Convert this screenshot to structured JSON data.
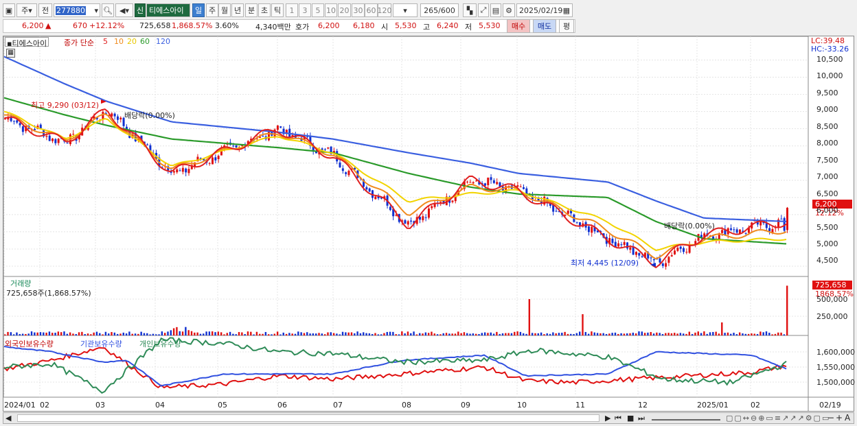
{
  "toolbar": {
    "code_prefix": "주",
    "all_label": "전",
    "stock_code": "277880",
    "credit_badge": "신",
    "stock_name": "티에스아이",
    "periods": [
      "일",
      "주",
      "월",
      "년",
      "분",
      "초",
      "틱"
    ],
    "minute_options": [
      "1",
      "3",
      "5",
      "10",
      "20",
      "30",
      "60",
      "120"
    ],
    "count_display": "265",
    "count_total": "/600",
    "date_value": "2025/02/19"
  },
  "quote": {
    "price": "6,200",
    "change": "670",
    "change_pct": "+12.12%",
    "volume": "725,658",
    "volume_ratio": "1,868.57%",
    "turnover": "3.60%",
    "amount": "4,340백만",
    "bid_label": "호가",
    "bid1": "6,200",
    "bid2": "6,180",
    "open_label": "시",
    "open": "5,530",
    "high_label": "고",
    "high": "6,240",
    "low_label": "저",
    "low": "5,530",
    "buy_label": "매수",
    "sell_label": "매도",
    "flat_label": "평"
  },
  "legend": {
    "name": "티에스아이",
    "ma_title": "종가 단순",
    "ma_periods": [
      "5",
      "10",
      "20",
      "60",
      "120"
    ],
    "lc": "LC:39.48",
    "hc": "HC:-33.26",
    "volume_title": "거래량",
    "volume_info": "725,658주(1,868.57%)",
    "holdings": [
      "외국인보유수량",
      "기관보유수량",
      "개인보유수량"
    ]
  },
  "annotations": {
    "high": "최고 9,290 (03/12)",
    "low": "최저 4,445 (12/09)",
    "dividend": "배당락(0.00%)",
    "last_price": "6,200",
    "last_pct": "12.12%",
    "last_volume": "725,658",
    "last_volume_pct": "1868.57%"
  },
  "axes": {
    "price_ticks": [
      "10,500",
      "10,000",
      "9,500",
      "9,000",
      "8,500",
      "8,000",
      "7,500",
      "7,000",
      "6,500",
      "6,000",
      "5,500",
      "5,000",
      "4,500"
    ],
    "volume_ticks": [
      "500,000",
      "250,000"
    ],
    "holding_ticks": [
      "1,600,000",
      "1,550,000",
      "1,500,000"
    ],
    "date_labels": [
      "2024/01",
      "02",
      "03",
      "04",
      "05",
      "06",
      "07",
      "08",
      "09",
      "10",
      "11",
      "12",
      "2025/01",
      "02"
    ],
    "end_date": "02/19"
  },
  "colors": {
    "ma5": "#e02020",
    "ma10": "#f08a1c",
    "ma20": "#f2d400",
    "ma60": "#2a9a2a",
    "ma120": "#3a5fe0",
    "up": "#e01010",
    "down": "#1030d0",
    "foreign": "#e01010",
    "institution": "#3050e0",
    "individual": "#2e8b57"
  },
  "chart_data": {
    "type": "line",
    "ma_keyframes": {
      "dates": [
        "2024/01/02",
        "2024/02/15",
        "2024/03/12",
        "2024/04/20",
        "2024/06/05",
        "2024/07/10",
        "2024/08/12",
        "2024/09/10",
        "2024/10/10",
        "2024/11/20",
        "2024/12/09",
        "2025/01/05",
        "2025/02/19"
      ],
      "ma5": [
        8800,
        8100,
        9050,
        7200,
        8500,
        7700,
        5700,
        7000,
        6700,
        5300,
        4600,
        5400,
        5800
      ],
      "ma20": [
        9000,
        8200,
        8800,
        7400,
        8300,
        7800,
        6400,
        6600,
        6700,
        5800,
        5000,
        5200,
        5300
      ],
      "ma60": [
        9400,
        8900,
        8600,
        8200,
        7950,
        7800,
        7200,
        6800,
        6600,
        6500,
        5800,
        5300,
        5150
      ],
      "ma120": [
        10600,
        9800,
        9300,
        8700,
        8400,
        8200,
        7800,
        7500,
        7200,
        6950,
        6400,
        5900,
        5800
      ]
    },
    "high": {
      "value": 9290,
      "date": "03/12"
    },
    "low": {
      "value": 4445,
      "date": "12/09"
    },
    "last_close": 6200,
    "last_volume": 725658
  }
}
